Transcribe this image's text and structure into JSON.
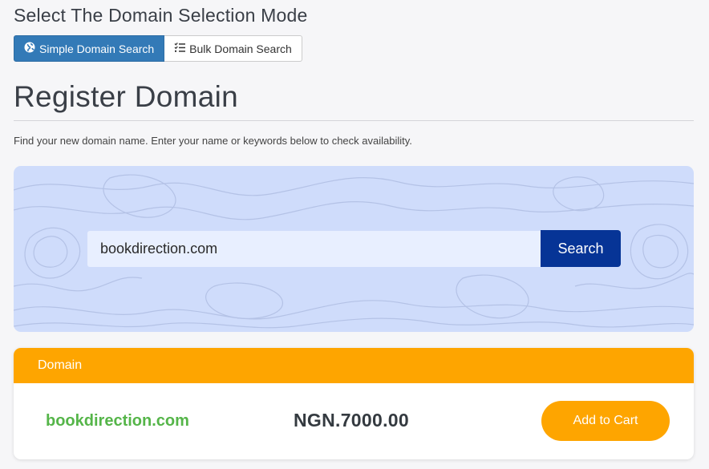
{
  "mode_selector": {
    "title": "Select The Domain Selection Mode",
    "simple_label": "Simple Domain Search",
    "bulk_label": "Bulk Domain Search",
    "simple_icon": "globe-icon",
    "bulk_icon": "list-check-icon"
  },
  "register": {
    "title": "Register Domain",
    "intro": "Find your new domain name. Enter your name or keywords below to check availability."
  },
  "search": {
    "value": "bookdirection.com",
    "button_label": "Search"
  },
  "results": {
    "header": "Domain",
    "domain": "bookdirection.com",
    "price": "NGN.7000.00",
    "cart_label": "Add to Cart"
  },
  "colors": {
    "primary_blue": "#337ab7",
    "search_button": "#063496",
    "panel_bg": "#cfdcfb",
    "accent_orange": "#fea500",
    "available_green": "#55b549"
  }
}
